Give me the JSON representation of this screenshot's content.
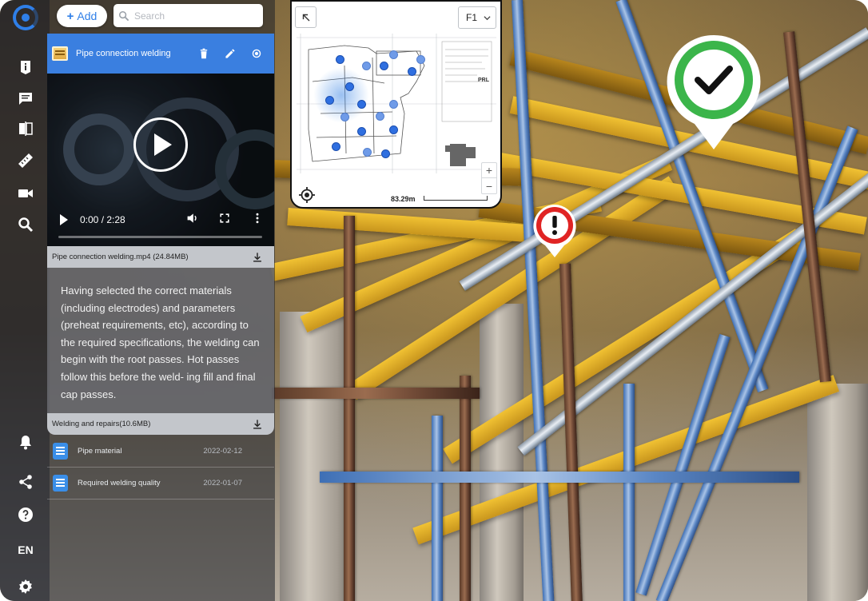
{
  "toolbar": {
    "add_label": "Add",
    "search_placeholder": "Search"
  },
  "selected_item": {
    "title": "Pipe connection welding"
  },
  "video": {
    "time": "0:00 / 2:28",
    "progress": 0
  },
  "attachments": [
    {
      "name": "Pipe connection welding.mp4 (24.84MB)"
    },
    {
      "name": "Welding and repairs(10.6MB)"
    }
  ],
  "description": "Having selected the correct materials (including electrodes) and parameters (preheat requirements, etc), according to the required specifications, the welding can begin with the root passes. Hot passes follow this before the weld- ing fill and final cap passes.",
  "documents": [
    {
      "name": "Pipe material",
      "date": "2022-02-12"
    },
    {
      "name": "Required welding quality",
      "date": "2022-01-07"
    }
  ],
  "minimap": {
    "floor": "F1",
    "scale": "83.29m"
  },
  "rail": {
    "language": "EN"
  },
  "colors": {
    "accent": "#3a7fe0",
    "ok_marker": "#3bb54a",
    "warn_marker": "#e02424"
  },
  "icons": {
    "rail_top": [
      "info-icon",
      "comment-icon",
      "compare-icon",
      "ruler-icon",
      "video-camera-icon",
      "search-icon"
    ],
    "rail_bottom": [
      "bell-icon",
      "share-icon",
      "help-icon",
      "settings-icon"
    ]
  }
}
